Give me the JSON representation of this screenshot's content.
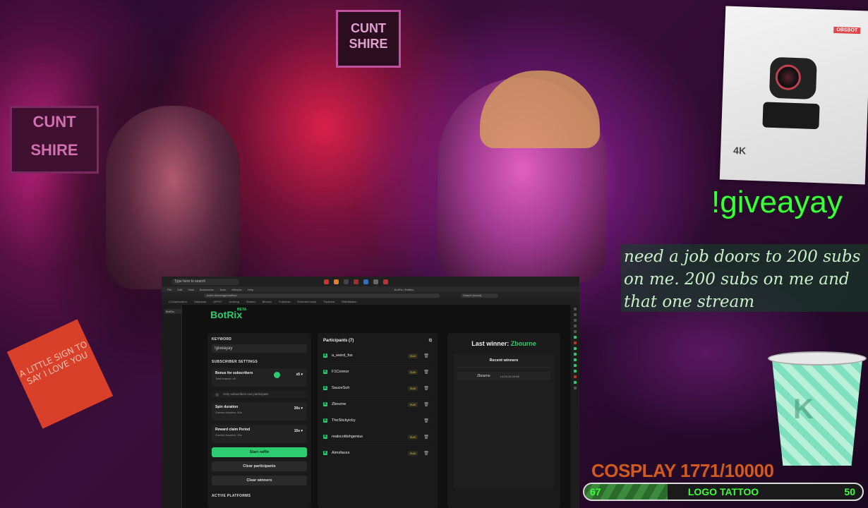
{
  "scene": {
    "poster_left_text": "CUNT SHIRE",
    "poster_top_text": "CUNT SHIRE",
    "sign_text": "A LITTLE SIGN TO SAY I LOVE YOU"
  },
  "taskbar": {
    "search_placeholder": "Type here to search"
  },
  "browser": {
    "menu": [
      "File",
      "Edit",
      "View",
      "Bookmarks",
      "Tools",
      "Window",
      "Help"
    ],
    "window_title": "BotRix | Raffles",
    "address": "botrix.live/widget/raffles/",
    "search_placeholder": "Search (boost)",
    "bookmarks": [
      "CLEtarlovision",
      "Oddpedia",
      "GIPHY",
      "Umbrog",
      "Stream",
      "Bimson",
      "Fotmbuw",
      "Extended tools",
      "Tripleckd",
      "RMMfastton"
    ]
  },
  "app": {
    "logo": "BotRix",
    "logo_badge": "BETA",
    "keyword_label": "KEYWORD",
    "keyword_value": "!giveayay",
    "subscriber_settings_label": "SUBSCRIBER SETTINGS",
    "bonus": {
      "title": "Bonus for subscribers",
      "subtitle": "Total chance: x5",
      "value": "x5"
    },
    "only_subs_label": "Only subscribers can participate",
    "spin": {
      "title": "Spin duration",
      "subtitle": "Current duration: 30s",
      "value": "30s"
    },
    "reward": {
      "title": "Reward claim Period",
      "subtitle": "Current duration: 15s",
      "value": "15s"
    },
    "start_button": "Start raffle",
    "clear_participants_button": "Clear participants",
    "clear_winners_button": "Clear winners",
    "active_platforms_label": "ACTIVE PLATFORMS",
    "participants_title": "Participants (7)",
    "participants": [
      {
        "name": "a_weird_fox",
        "sub": "SUB"
      },
      {
        "name": "F1Connor",
        "sub": "SUB"
      },
      {
        "name": "SauceSuh",
        "sub": "SUB"
      },
      {
        "name": "Zbourne",
        "sub": "SUB"
      },
      {
        "name": "TheStickyicky",
        "sub": ""
      },
      {
        "name": "realscottishgenius",
        "sub": "SUB"
      },
      {
        "name": "Aimsfaces",
        "sub": "SUB"
      }
    ],
    "last_winner_label": "Last winner:",
    "last_winner_name": "Zbourne",
    "recent_winners_title": "Recent winners",
    "recent_winner": {
      "name": "Zbourne",
      "date": "14-03-24 20:48"
    }
  },
  "overlay": {
    "product_brand": "OBSBOT",
    "product_label": "4K",
    "command": "!giveayay",
    "chat_message": "need a job doors to 200 subs on me. 200 subs on me and that one stream",
    "goal_title": "COSPLAY 1771/10000",
    "goal_left": "67",
    "goal_center": "LOGO TATTOO",
    "goal_right": "50",
    "goal_progress": 0.3
  },
  "colors": {
    "accent": "#2ecc71",
    "command_green": "#3cff3c",
    "goal_orange": "#d05a20"
  }
}
